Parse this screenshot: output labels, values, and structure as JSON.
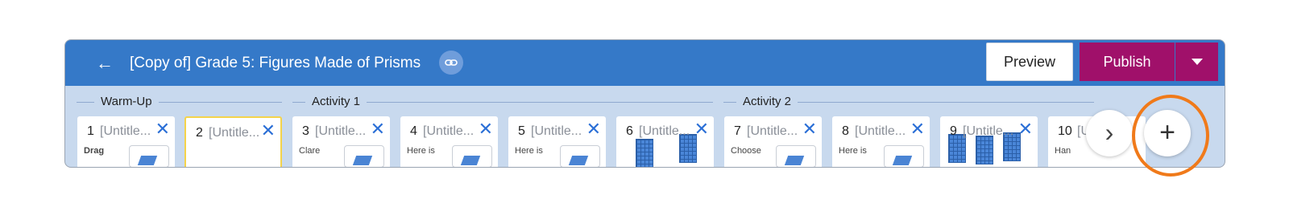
{
  "header": {
    "title": "[Copy of] Grade 5: Figures Made of Prisms",
    "preview_label": "Preview",
    "publish_label": "Publish"
  },
  "sections": [
    {
      "label": "Warm-Up"
    },
    {
      "label": "Activity 1"
    },
    {
      "label": "Activity 2"
    }
  ],
  "cards": [
    {
      "num": "1",
      "name": "[Untitle...",
      "snippet": "Drag",
      "thumb": true
    },
    {
      "num": "2",
      "name": "[Untitle...",
      "snippet": "",
      "thumb": false
    },
    {
      "num": "3",
      "name": "[Untitle...",
      "snippet": "Clare",
      "thumb": true
    },
    {
      "num": "4",
      "name": "[Untitle...",
      "snippet": "Here is",
      "thumb": true
    },
    {
      "num": "5",
      "name": "[Untitle...",
      "snippet": "Here is",
      "thumb": true
    },
    {
      "num": "6",
      "name": "[Untitle...",
      "snippet": "",
      "thumb": false
    },
    {
      "num": "7",
      "name": "[Untitle...",
      "snippet": "Choose",
      "thumb": true
    },
    {
      "num": "8",
      "name": "[Untitle...",
      "snippet": "Here is",
      "thumb": true
    },
    {
      "num": "9",
      "name": "[Untitle...",
      "snippet": "",
      "thumb": false
    },
    {
      "num": "10",
      "name": "[U",
      "snippet": "Han",
      "thumb": false
    }
  ],
  "icons": {
    "back": "arrow-left-icon",
    "link": "link-icon",
    "close": "close-icon",
    "next": "chevron-right-icon",
    "add": "plus-icon"
  },
  "colors": {
    "header_blue": "#3579c8",
    "publish": "#a0106a",
    "annotation_orange": "#f07a1a",
    "selected_card_border": "#f4d34b"
  }
}
